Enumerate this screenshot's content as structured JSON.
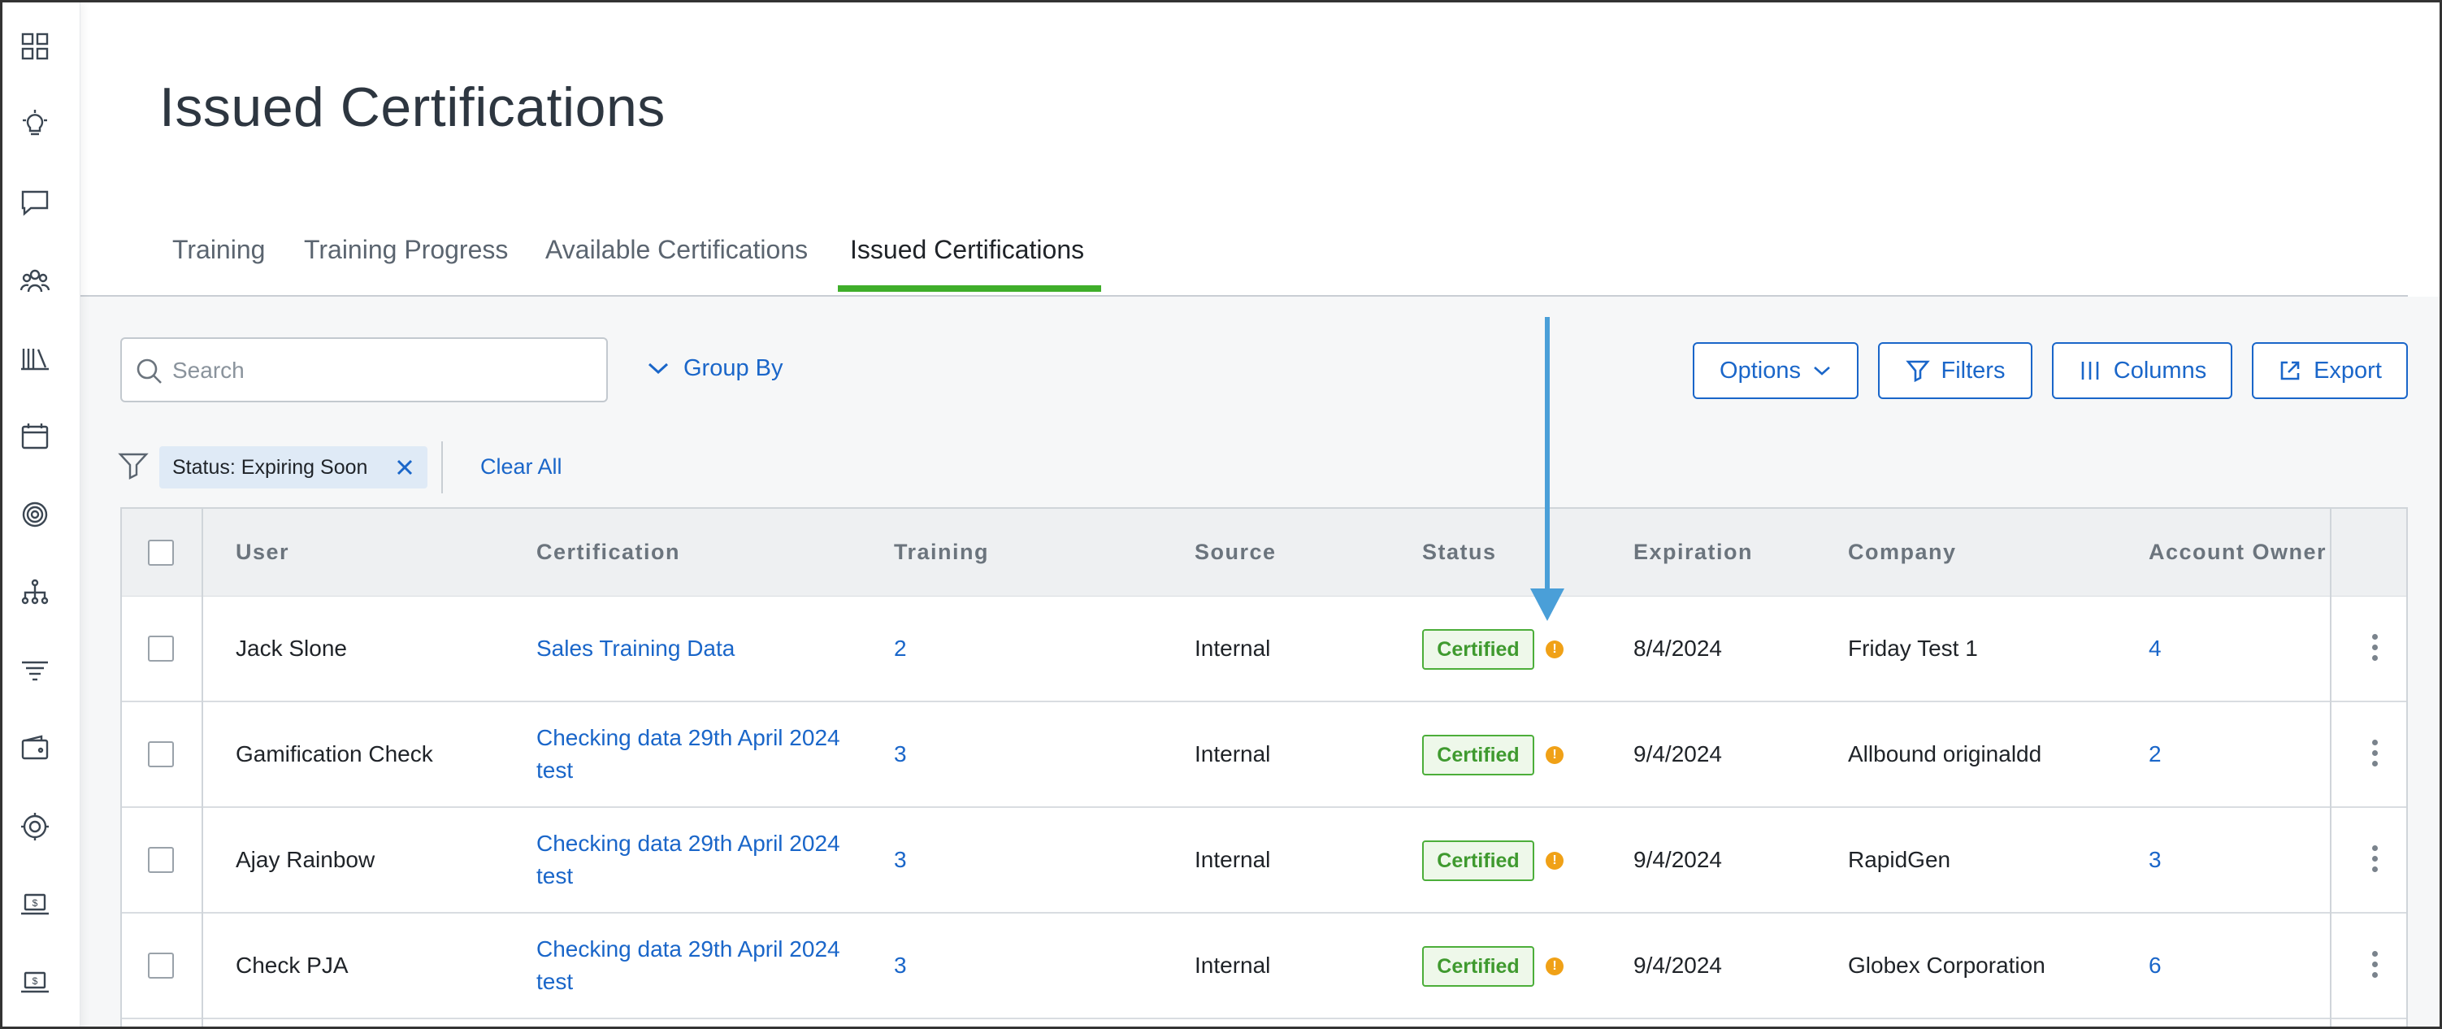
{
  "page": {
    "title": "Issued Certifications"
  },
  "sidebar": {
    "icons": [
      "dashboard-icon",
      "lightbulb-icon",
      "chat-icon",
      "people-icon",
      "library-icon",
      "calendar-icon",
      "target-icon",
      "org-chart-icon",
      "filter-lines-icon",
      "wallet-icon",
      "gear-network-icon",
      "laptop-dollar-icon",
      "laptop-dollar-icon"
    ]
  },
  "tabs": [
    {
      "label": "Training",
      "active": false
    },
    {
      "label": "Training Progress",
      "active": false
    },
    {
      "label": "Available Certifications",
      "active": false
    },
    {
      "label": "Issued Certifications",
      "active": true
    }
  ],
  "toolbar": {
    "search_placeholder": "Search",
    "group_by": "Group By",
    "options": "Options",
    "filters": "Filters",
    "columns": "Columns",
    "export": "Export"
  },
  "filters": {
    "chip": "Status: Expiring Soon",
    "clear_all": "Clear All"
  },
  "table": {
    "headers": [
      "User",
      "Certification",
      "Training",
      "Source",
      "Status",
      "Expiration",
      "Company",
      "Account Owner"
    ],
    "rows": [
      {
        "user": "Jack Slone",
        "certification": [
          "Sales Training Data"
        ],
        "training": "2",
        "source": "Internal",
        "status": "Certified",
        "expiration": "8/4/2024",
        "company": "Friday Test 1",
        "account_owner": "4"
      },
      {
        "user": "Gamification Check",
        "certification": [
          "Checking data 29th April 2024",
          "test"
        ],
        "training": "3",
        "source": "Internal",
        "status": "Certified",
        "expiration": "9/4/2024",
        "company": "Allbound originaldd",
        "account_owner": "2"
      },
      {
        "user": "Ajay Rainbow",
        "certification": [
          "Checking data 29th April 2024",
          "test"
        ],
        "training": "3",
        "source": "Internal",
        "status": "Certified",
        "expiration": "9/4/2024",
        "company": "RapidGen",
        "account_owner": "3"
      },
      {
        "user": "Check PJA",
        "certification": [
          "Checking data 29th April 2024",
          "test"
        ],
        "training": "3",
        "source": "Internal",
        "status": "Certified",
        "expiration": "9/4/2024",
        "company": "Globex Corporation",
        "account_owner": "6"
      }
    ]
  },
  "colors": {
    "accent": "#1a66c9",
    "active_tab": "#3fae2a",
    "certified": "#3f9a2f",
    "warning": "#f0a117",
    "annotation_arrow": "#4a9fd8"
  }
}
